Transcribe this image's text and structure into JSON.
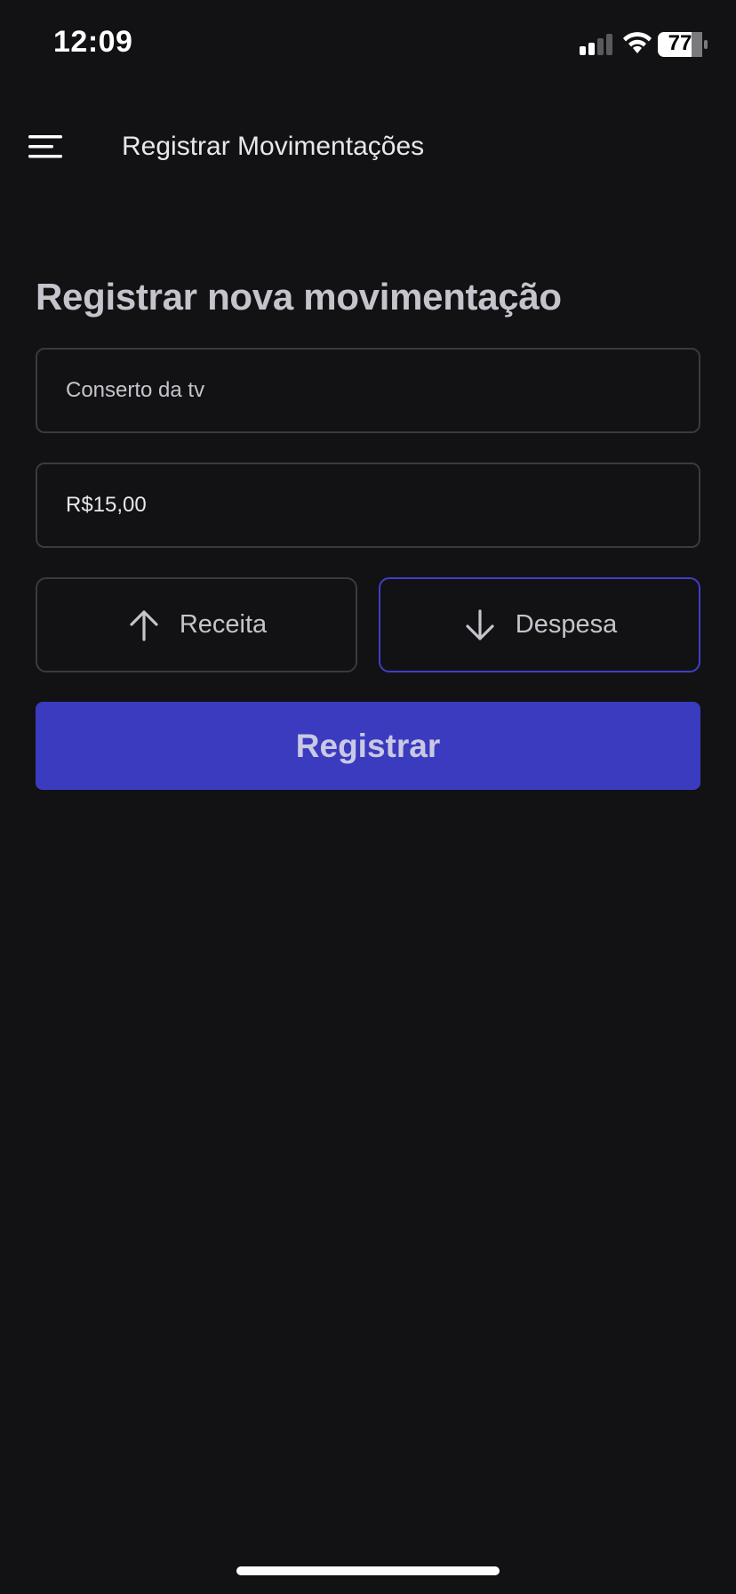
{
  "status_bar": {
    "time": "12:09",
    "battery": "77",
    "icons": [
      "signal-icon",
      "wifi-icon",
      "battery-icon"
    ]
  },
  "header": {
    "menu_icon": "hamburger-menu-icon",
    "title": "Registrar Movimentações"
  },
  "form": {
    "title": "Registrar nova movimentação",
    "description": {
      "value": "Conserto da tv"
    },
    "amount": {
      "value": "R$15,00"
    },
    "type_options": [
      {
        "label": "Receita",
        "icon": "arrow-up-icon",
        "selected": false
      },
      {
        "label": "Despesa",
        "icon": "arrow-down-icon",
        "selected": true
      }
    ],
    "submit_label": "Registrar"
  },
  "colors": {
    "background": "#121214",
    "accent": "#3b3bc0",
    "selected_border": "#3f3fc8",
    "border": "#3a3a3f",
    "text_muted": "#c4c4cc"
  }
}
